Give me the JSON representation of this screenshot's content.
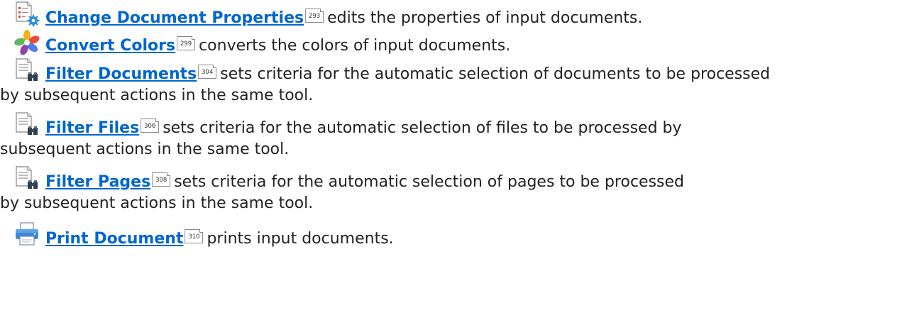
{
  "entries": [
    {
      "icon": "document-properties-icon",
      "link": "Change Document Properties",
      "page": "293",
      "lines": [
        "edits the properties of input documents."
      ]
    },
    {
      "icon": "convert-colors-icon",
      "link": "Convert Colors",
      "page": "299",
      "lines": [
        "converts the colors of input documents."
      ]
    },
    {
      "icon": "filter-binoculars-icon",
      "link": "Filter Documents",
      "page": "304",
      "lines": [
        "sets criteria for the automatic selection of documents to be processed",
        "by subsequent actions in the same tool."
      ]
    },
    {
      "icon": "filter-binoculars-icon",
      "link": "Filter Files",
      "page": "306",
      "lines": [
        "sets criteria for the automatic selection of files to be processed by",
        "subsequent actions in the same tool."
      ]
    },
    {
      "icon": "filter-binoculars-icon",
      "link": "Filter Pages",
      "page": "308",
      "lines": [
        "sets criteria for the automatic selection of pages to be processed",
        "by subsequent actions in the same tool."
      ]
    },
    {
      "icon": "printer-icon",
      "link": "Print Document",
      "page": "310",
      "lines": [
        "prints input documents."
      ]
    }
  ]
}
